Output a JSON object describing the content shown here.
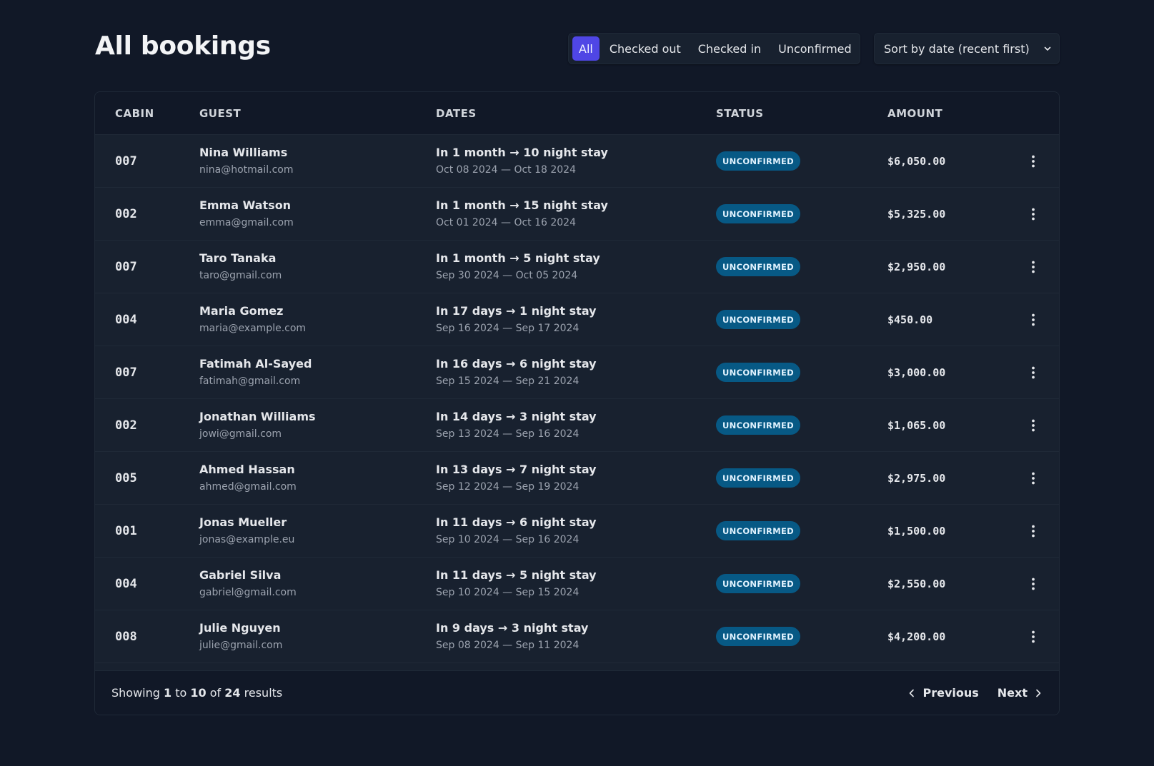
{
  "page": {
    "title": "All bookings"
  },
  "filter": {
    "options": [
      "All",
      "Checked out",
      "Checked in",
      "Unconfirmed"
    ],
    "active": "All"
  },
  "sort": {
    "selected": "Sort by date (recent first)"
  },
  "table": {
    "headers": [
      "CABIN",
      "GUEST",
      "DATES",
      "STATUS",
      "AMOUNT"
    ],
    "rows": [
      {
        "cabin": "007",
        "guest": "Nina Williams",
        "email": "nina@hotmail.com",
        "stay": "In 1 month → 10 night stay",
        "dates": "Oct 08 2024 — Oct 18 2024",
        "status": "UNCONFIRMED",
        "amount": "$6,050.00"
      },
      {
        "cabin": "002",
        "guest": "Emma Watson",
        "email": "emma@gmail.com",
        "stay": "In 1 month → 15 night stay",
        "dates": "Oct 01 2024 — Oct 16 2024",
        "status": "UNCONFIRMED",
        "amount": "$5,325.00"
      },
      {
        "cabin": "007",
        "guest": "Taro Tanaka",
        "email": "taro@gmail.com",
        "stay": "In 1 month → 5 night stay",
        "dates": "Sep 30 2024 — Oct 05 2024",
        "status": "UNCONFIRMED",
        "amount": "$2,950.00"
      },
      {
        "cabin": "004",
        "guest": "Maria Gomez",
        "email": "maria@example.com",
        "stay": "In 17 days → 1 night stay",
        "dates": "Sep 16 2024 — Sep 17 2024",
        "status": "UNCONFIRMED",
        "amount": "$450.00"
      },
      {
        "cabin": "007",
        "guest": "Fatimah Al-Sayed",
        "email": "fatimah@gmail.com",
        "stay": "In 16 days → 6 night stay",
        "dates": "Sep 15 2024 — Sep 21 2024",
        "status": "UNCONFIRMED",
        "amount": "$3,000.00"
      },
      {
        "cabin": "002",
        "guest": "Jonathan Williams",
        "email": "jowi@gmail.com",
        "stay": "In 14 days → 3 night stay",
        "dates": "Sep 13 2024 — Sep 16 2024",
        "status": "UNCONFIRMED",
        "amount": "$1,065.00"
      },
      {
        "cabin": "005",
        "guest": "Ahmed Hassan",
        "email": "ahmed@gmail.com",
        "stay": "In 13 days → 7 night stay",
        "dates": "Sep 12 2024 — Sep 19 2024",
        "status": "UNCONFIRMED",
        "amount": "$2,975.00"
      },
      {
        "cabin": "001",
        "guest": "Jonas Mueller",
        "email": "jonas@example.eu",
        "stay": "In 11 days → 6 night stay",
        "dates": "Sep 10 2024 — Sep 16 2024",
        "status": "UNCONFIRMED",
        "amount": "$1,500.00"
      },
      {
        "cabin": "004",
        "guest": "Gabriel Silva",
        "email": "gabriel@gmail.com",
        "stay": "In 11 days → 5 night stay",
        "dates": "Sep 10 2024 — Sep 15 2024",
        "status": "UNCONFIRMED",
        "amount": "$2,550.00"
      },
      {
        "cabin": "008",
        "guest": "Julie Nguyen",
        "email": "julie@gmail.com",
        "stay": "In 9 days → 3 night stay",
        "dates": "Sep 08 2024 — Sep 11 2024",
        "status": "UNCONFIRMED",
        "amount": "$4,200.00"
      }
    ]
  },
  "footer": {
    "showing_prefix": "Showing",
    "from": "1",
    "to_word": "to",
    "to": "10",
    "of_word": "of",
    "total": "24",
    "suffix": "results",
    "previous_label": "Previous",
    "next_label": "Next"
  },
  "icons": {
    "row_menu": "vertical-dots-icon",
    "sort_chevron": "chevron-down-icon",
    "previous": "chevron-left-icon",
    "next": "chevron-right-icon"
  },
  "colors": {
    "background": "#111827",
    "surface": "#18212f",
    "accent": "#4f46e5",
    "badge_unconfirmed_bg": "#075985",
    "badge_unconfirmed_text": "#e0f2fe"
  }
}
